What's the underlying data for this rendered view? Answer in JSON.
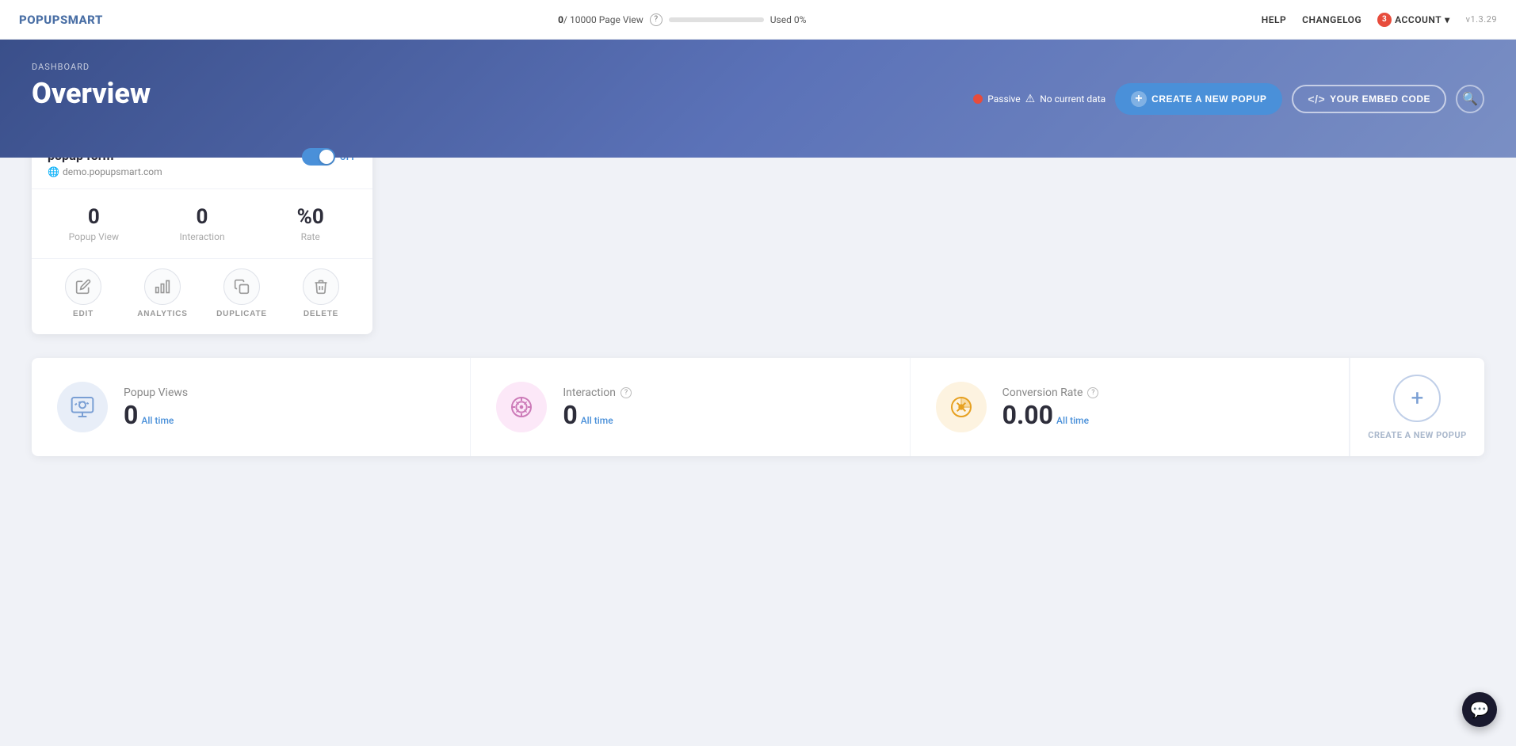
{
  "topnav": {
    "logo": "POPUPSMART",
    "pageview": {
      "current": "0",
      "total": "10000",
      "label": "Page View",
      "used_percent": "Used 0%",
      "progress_width": "0%"
    },
    "help_label": "?",
    "links": {
      "help": "HELP",
      "changelog": "CHANGELOG",
      "account": "ACCOUNT",
      "account_count": "3"
    },
    "version": "v1.3.29"
  },
  "header": {
    "breadcrumb": "DASHBOARD",
    "title": "Overview",
    "status": {
      "dot_label": "Passive",
      "warning": "⚠",
      "text": "No current data"
    },
    "btn_create": "CREATE A NEW POPUP",
    "btn_embed": "YOUR EMBED CODE"
  },
  "popup_card": {
    "title": "popup form",
    "url": "demo.popupsmart.com",
    "toggle_label": "OFF",
    "stats": {
      "popup_view": {
        "value": "0",
        "label": "Popup View"
      },
      "interaction": {
        "value": "0",
        "label": "Interaction"
      },
      "rate": {
        "value": "%0",
        "label": "Rate"
      }
    },
    "actions": {
      "edit": "EDIT",
      "analytics": "ANALYTICS",
      "duplicate": "DUPLICATE",
      "delete": "DELETE"
    }
  },
  "stats_panel": {
    "popup_views": {
      "name": "Popup Views",
      "value": "0",
      "alltime": "All time"
    },
    "interaction": {
      "name": "Interaction",
      "value": "0",
      "alltime": "All time"
    },
    "conversion_rate": {
      "name": "Conversion Rate",
      "value": "0.00",
      "alltime": "All time"
    },
    "create_label": "CREATE A NEW POPUP"
  },
  "chat_widget": {
    "icon": "💬"
  }
}
